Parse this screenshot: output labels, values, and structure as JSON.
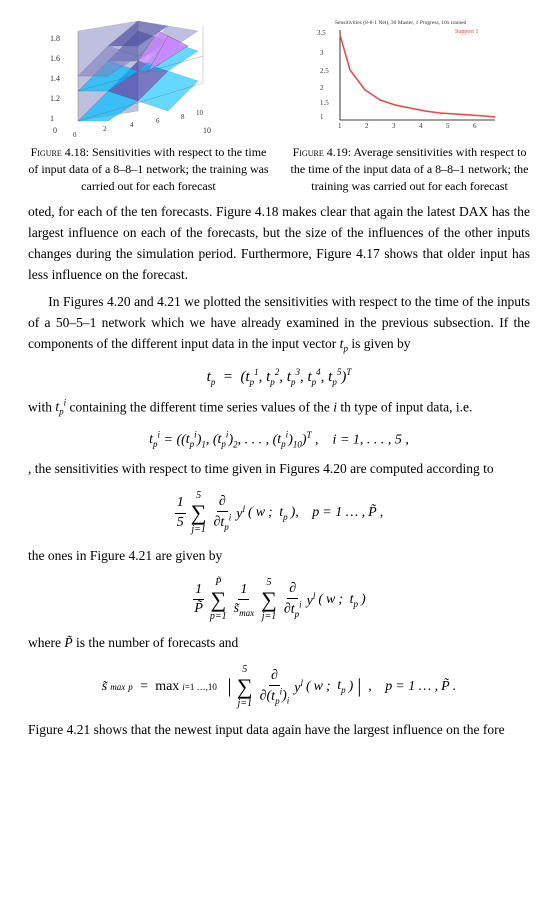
{
  "figures": {
    "fig18": {
      "label": "Figure 4.18:",
      "caption": "Sensitivities with respect to the time of input data of a 8–8–1 network; the training was carried out for each forecast"
    },
    "fig19": {
      "label": "Figure 4.19:",
      "caption": "Average sensitivities with respect to the time of the input data of a 8–8–1 network; the training was carried out for each forecast"
    }
  },
  "paragraphs": {
    "p1": "oted, for each of the ten forecasts. Figure 4.18 makes clear that again the latest DAX has the largest influence on each of the forecasts, but the size of the influences of the other inputs changes during the simulation period. Furthermore, Figure 4.17 shows that older input has less influence on the forecast.",
    "p2": "In Figures 4.20 and 4.21 we plotted the sensitivities with respect to the time of the inputs of a 50–5–1 network which we have already examined in the previous subsection. If the components of the different input data in the input vector ",
    "tp_var": "t",
    "tp_sub": "p",
    "p2b": " is given by",
    "eq1_main": "t",
    "eq1_rhs": "(t",
    "eq1_rhs2": ", t",
    "eq1_rhs3": ", t",
    "eq1_rhs4": ", t",
    "eq1_rhs5": ", t",
    "p3": "with ",
    "ti_label": "t",
    "p3b": " containing the different time series values of the ",
    "ith": "i",
    "p3c": "th type of input data, i.e.",
    "eq2_lhs": "t",
    "eq2_rhs": "((t",
    "eq2_rhs2": ")",
    "p4": ", the sensitivities with respect to time given in Figures 4.20 are computed according to",
    "sum_label1": "1/5 ∑ ∂/∂t_p^i y^l(w; t_p),   p = 1 … P̃,",
    "p5": "the ones in Figure 4.21 are given by",
    "sum_label2": "1/P̃ ∑ 1/s̃_max ∑ ∂/∂t_p^i y^l(w; t_p)",
    "p6": "where ",
    "Ptilde": "P̃",
    "p6b": " is the number of forecasts and",
    "eq_smax": "s̃_max^p = max_{i=1,...,10} |∑ ∂/∂(t_p^i)_i y^l(w; t_p)|,   p = 1 … P̃.",
    "p7": "Figure 4.21 shows that the newest input data again have the largest influence on the fore"
  },
  "math": {
    "tp_vector": "t_p = (t_p^1, t_p^2, t_p^3, t_p^4, t_p^5)^T",
    "ti_vector": "t_p^i = ((t_p^i)_1, (t_p^i)_2, ..., (t_p^i)_10)^T,   i = 1,...,5,",
    "sum1": "\\frac{1}{5} \\sum_{j=1}^{5} \\frac{\\partial}{\\partial t_p^i} y^l(w; t_p),",
    "sum2": "\\frac{1}{\\tilde{P}} \\sum_{p=1}^{\\tilde{P}} \\frac{1}{\\tilde{s}^p_{\\max}} \\sum_{j=1}^{5} \\frac{\\partial}{\\partial t_p^i} y^l(w; t_p)",
    "smax": "\\tilde{s}^p_{\\max} = \\max_{i=1,...,10} \\left| \\sum_{j=1}^{5} \\frac{\\partial}{\\partial (t_p^i)_i} y^l(w; t_p) \\right|,"
  }
}
